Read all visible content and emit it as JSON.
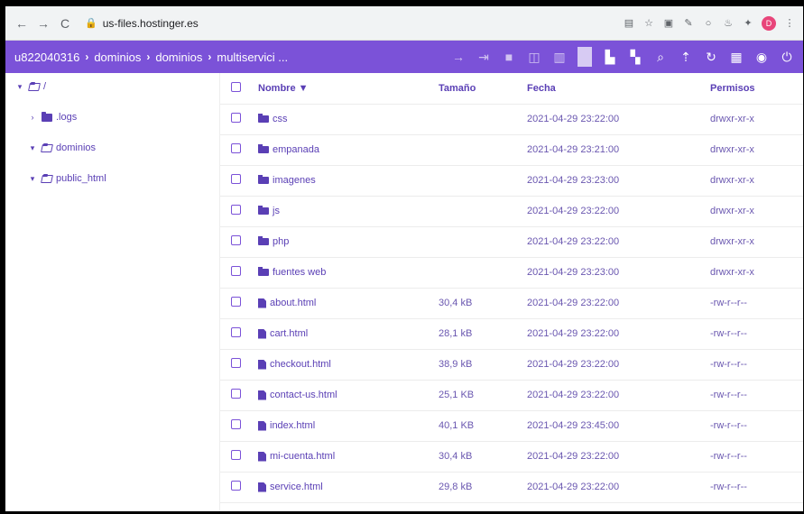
{
  "browser": {
    "url": "us-files.hostinger.es"
  },
  "toolbar": {
    "crumbs": [
      "u822040316",
      "dominios",
      "dominios",
      "multiservici ..."
    ]
  },
  "sidebar": {
    "items": [
      {
        "label": "/",
        "level": 0
      },
      {
        "label": ".logs",
        "level": 1
      },
      {
        "label": "dominios",
        "level": 1
      },
      {
        "label": "public_html",
        "level": 1
      }
    ]
  },
  "table": {
    "headers": {
      "name": "Nombre ▼",
      "size": "Tamaño",
      "date": "Fecha",
      "perm": "Permisos"
    },
    "rows": [
      {
        "type": "folder",
        "name": "css",
        "size": "",
        "date": "2021-04-29 23:22:00",
        "perm": "drwxr-xr-x"
      },
      {
        "type": "folder",
        "name": "empanada",
        "size": "",
        "date": "2021-04-29 23:21:00",
        "perm": "drwxr-xr-x"
      },
      {
        "type": "folder",
        "name": "imagenes",
        "size": "",
        "date": "2021-04-29 23:23:00",
        "perm": "drwxr-xr-x"
      },
      {
        "type": "folder",
        "name": "js",
        "size": "",
        "date": "2021-04-29 23:22:00",
        "perm": "drwxr-xr-x"
      },
      {
        "type": "folder",
        "name": "php",
        "size": "",
        "date": "2021-04-29 23:22:00",
        "perm": "drwxr-xr-x"
      },
      {
        "type": "folder",
        "name": "fuentes web",
        "size": "",
        "date": "2021-04-29 23:23:00",
        "perm": "drwxr-xr-x"
      },
      {
        "type": "file",
        "name": "about.html",
        "size": "30,4 kB",
        "date": "2021-04-29 23:22:00",
        "perm": "-rw-r--r--"
      },
      {
        "type": "file",
        "name": "cart.html",
        "size": "28,1 kB",
        "date": "2021-04-29 23:22:00",
        "perm": "-rw-r--r--"
      },
      {
        "type": "file",
        "name": "checkout.html",
        "size": "38,9 kB",
        "date": "2021-04-29 23:22:00",
        "perm": "-rw-r--r--"
      },
      {
        "type": "file",
        "name": "contact-us.html",
        "size": "25,1 KB",
        "date": "2021-04-29 23:22:00",
        "perm": "-rw-r--r--"
      },
      {
        "type": "file",
        "name": "index.html",
        "size": "40,1 KB",
        "date": "2021-04-29 23:45:00",
        "perm": "-rw-r--r--"
      },
      {
        "type": "file",
        "name": "mi-cuenta.html",
        "size": "30,4 kB",
        "date": "2021-04-29 23:22:00",
        "perm": "-rw-r--r--"
      },
      {
        "type": "file",
        "name": "service.html",
        "size": "29,8 kB",
        "date": "2021-04-29 23:22:00",
        "perm": "-rw-r--r--"
      }
    ]
  },
  "colors": {
    "accent": "#7b52d8",
    "text": "#5a3fb5"
  }
}
